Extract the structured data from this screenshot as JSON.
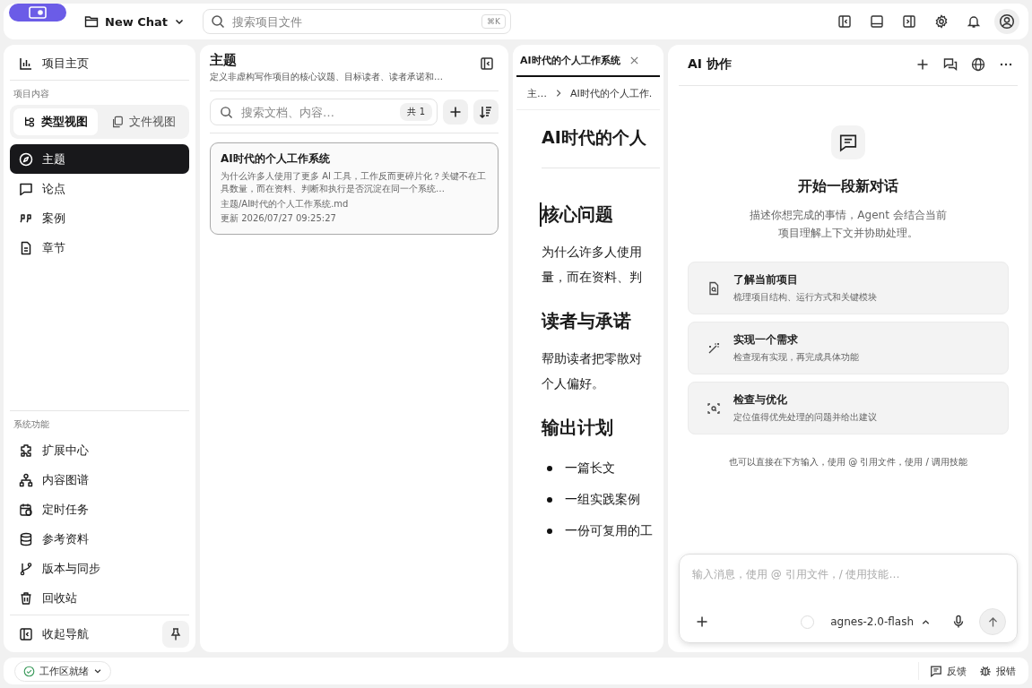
{
  "header": {
    "project": "New Chat",
    "search": {
      "placeholder": "搜索项目文件",
      "shortcut": "⌘K"
    }
  },
  "sidebar": {
    "home": "项目主页",
    "section_label": "项目内容",
    "view_toggle": [
      {
        "label": "类型视图",
        "selected": true
      },
      {
        "label": "文件视图",
        "selected": false
      }
    ],
    "content_items": [
      {
        "label": "主题",
        "selected": true
      },
      {
        "label": "论点",
        "selected": false
      },
      {
        "label": "案例",
        "selected": false
      },
      {
        "label": "章节",
        "selected": false
      }
    ],
    "system_label": "系统功能",
    "system_items": [
      "扩展中心",
      "内容图谱",
      "定时任务",
      "参考资料",
      "版本与同步",
      "回收站"
    ],
    "collapse": "收起导航"
  },
  "list_panel": {
    "title": "主题",
    "description": "定义非虚构写作项目的核心议题、目标读者、读者承诺和…",
    "search": {
      "placeholder": "搜索文档、内容…"
    },
    "count": "共 1",
    "documents": [
      {
        "title": "AI时代的个人工作系统",
        "excerpt": "为什么许多人使用了更多 AI 工具，工作反而更碎片化？关键不在工具数量，而在资料、判断和执行是否沉淀在同一个系统…",
        "path": "主题/AI时代的个人工作系统.md",
        "updated": "更新 2026/07/27 09:25:27",
        "selected": true
      }
    ]
  },
  "editor": {
    "tabs": [
      {
        "label": "AI时代的个人工作系统",
        "selected": true
      }
    ],
    "breadcrumb": [
      "主…",
      "AI时代的个人工作."
    ],
    "title": "AI时代的个人",
    "sections": [
      {
        "kind": "paragraph",
        "heading": "核心问题",
        "lines": [
          "为什么许多人使用",
          "量，而在资料、判"
        ]
      },
      {
        "kind": "paragraph",
        "heading": "读者与承诺",
        "lines": [
          "帮助读者把零散对",
          "个人偏好。"
        ]
      },
      {
        "kind": "bullets",
        "heading": "输出计划",
        "lines": [
          "一篇长文",
          "一组实践案例",
          "一份可复用的工"
        ]
      }
    ]
  },
  "assistant": {
    "title": "AI 协作",
    "empty_title": "开始一段新对话",
    "empty_text": "描述你想完成的事情，Agent 会结合当前项目理解上下文并协助处理。",
    "suggestions": [
      {
        "title": "了解当前项目",
        "description": "梳理项目结构、运行方式和关键模块"
      },
      {
        "title": "实现一个需求",
        "description": "检查现有实现，再完成具体功能"
      },
      {
        "title": "检查与优化",
        "description": "定位值得优先处理的问题并给出建议"
      }
    ],
    "hint": "也可以直接在下方输入，使用 @ 引用文件，使用 / 调用技能",
    "composer": {
      "placeholder": "输入消息，使用 @ 引用文件，/ 使用技能…",
      "model": "agnes-2.0-flash"
    }
  },
  "status_bar": {
    "workspace": "工作区就绪",
    "feedback": "反馈",
    "report": "报错"
  }
}
